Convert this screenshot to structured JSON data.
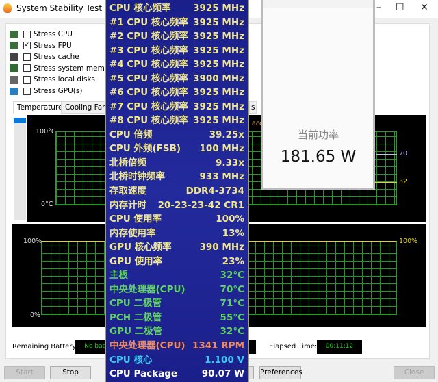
{
  "window": {
    "title": "System Stability Test - AIDA",
    "minimize": "–",
    "maximize": "☐",
    "close": "✕"
  },
  "options": [
    {
      "label": "Stress CPU",
      "checked": false,
      "icon": "cpu-icon"
    },
    {
      "label": "Stress FPU",
      "checked": true,
      "icon": "fpu-icon"
    },
    {
      "label": "Stress cache",
      "checked": false,
      "icon": "cache-icon"
    },
    {
      "label": "Stress system memory",
      "checked": false,
      "icon": "memory-icon"
    },
    {
      "label": "Stress local disks",
      "checked": false,
      "icon": "disk-icon"
    },
    {
      "label": "Stress GPU(s)",
      "checked": false,
      "icon": "gpu-icon"
    }
  ],
  "tabs": [
    "Temperatures",
    "Cooling Fans",
    "s"
  ],
  "graph1": {
    "top_label": "100°C",
    "bottom_label": "0°C",
    "legend_fragment": "acer",
    "value_a": "70",
    "value_b": "32"
  },
  "graph2": {
    "top_label": "100%",
    "bottom_label": "0%",
    "right_label": "100%"
  },
  "status": {
    "battery_label": "Remaining Battery:",
    "battery_value": "No batt",
    "elapsed_label": "Elapsed Time:",
    "elapsed_value": "00:11:12"
  },
  "buttons": {
    "start": "Start",
    "stop": "Stop",
    "preferences": "Preferences",
    "close": "Close"
  },
  "power_widget": {
    "label": "当前功率",
    "value": "181.65 W"
  },
  "osd": [
    {
      "label": "CPU 核心频率",
      "value": "3925 MHz",
      "color": "#f0e68c"
    },
    {
      "label": "#1 CPU 核心频率",
      "value": "3925 MHz",
      "color": "#f0e68c"
    },
    {
      "label": "#2 CPU 核心频率",
      "value": "3925 MHz",
      "color": "#f0e68c"
    },
    {
      "label": "#3 CPU 核心频率",
      "value": "3925 MHz",
      "color": "#f0e68c"
    },
    {
      "label": "#4 CPU 核心频率",
      "value": "3925 MHz",
      "color": "#f0e68c"
    },
    {
      "label": "#5 CPU 核心频率",
      "value": "3900 MHz",
      "color": "#f0e68c"
    },
    {
      "label": "#6 CPU 核心频率",
      "value": "3925 MHz",
      "color": "#f0e68c"
    },
    {
      "label": "#7 CPU 核心频率",
      "value": "3925 MHz",
      "color": "#f0e68c"
    },
    {
      "label": "#8 CPU 核心频率",
      "value": "3925 MHz",
      "color": "#f0e68c"
    },
    {
      "label": "CPU 倍频",
      "value": "39.25x",
      "color": "#f0e68c"
    },
    {
      "label": "CPU 外频(FSB)",
      "value": "100 MHz",
      "color": "#f0e68c"
    },
    {
      "label": "北桥倍频",
      "value": "9.33x",
      "color": "#f0e68c"
    },
    {
      "label": "北桥时钟频率",
      "value": "933 MHz",
      "color": "#f0e68c"
    },
    {
      "label": "存取速度",
      "value": "DDR4-3734",
      "color": "#f0e68c"
    },
    {
      "label": "内存计时",
      "value": "20-23-23-42 CR1",
      "color": "#f0e68c"
    },
    {
      "label": "CPU 使用率",
      "value": "100%",
      "color": "#f0e68c"
    },
    {
      "label": "内存使用率",
      "value": "13%",
      "color": "#f0e68c"
    },
    {
      "label": "GPU 核心频率",
      "value": "390 MHz",
      "color": "#f0e68c"
    },
    {
      "label": "GPU 使用率",
      "value": "23%",
      "color": "#f0e68c"
    },
    {
      "label": "主板",
      "value": "32°C",
      "color": "#5fd35f"
    },
    {
      "label": "中央处理器(CPU)",
      "value": "70°C",
      "color": "#5fd35f"
    },
    {
      "label": "CPU 二极管",
      "value": "71°C",
      "color": "#5fd35f"
    },
    {
      "label": "PCH 二极管",
      "value": "55°C",
      "color": "#5fd35f"
    },
    {
      "label": "GPU 二极管",
      "value": "32°C",
      "color": "#5fd35f"
    },
    {
      "label": "中央处理器(CPU)",
      "value": "1341 RPM",
      "color": "#f08a5a"
    },
    {
      "label": "CPU 核心",
      "value": "1.100 V",
      "color": "#3cc8f0"
    },
    {
      "label": "CPU Package",
      "value": "90.07 W",
      "color": "#ffffff"
    }
  ]
}
